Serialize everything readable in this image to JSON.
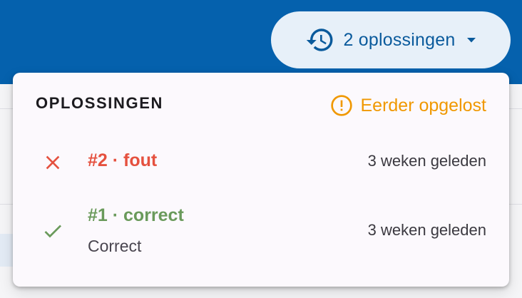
{
  "header_button": {
    "label": "2 oplossingen",
    "icon": "history-icon",
    "dropdown_icon": "caret-down-icon"
  },
  "dropdown": {
    "title": "OPLOSSINGEN",
    "earlier_solved": {
      "label": "Eerder opgelost",
      "icon": "alert-circle-icon"
    },
    "submissions": [
      {
        "title": "#2 · fout",
        "status": "fout",
        "icon": "close-icon",
        "subtitle": "",
        "time": "3 weken geleden"
      },
      {
        "title": "#1 · correct",
        "status": "correct",
        "icon": "check-icon",
        "subtitle": "Correct",
        "time": "3 weken geleden"
      }
    ]
  },
  "colors": {
    "topbar": "#0561ad",
    "button_background": "#e7f0f9",
    "button_text": "#0a5a9c",
    "warning": "#f09800",
    "error": "#e5513f",
    "success": "#6a9a5b"
  }
}
